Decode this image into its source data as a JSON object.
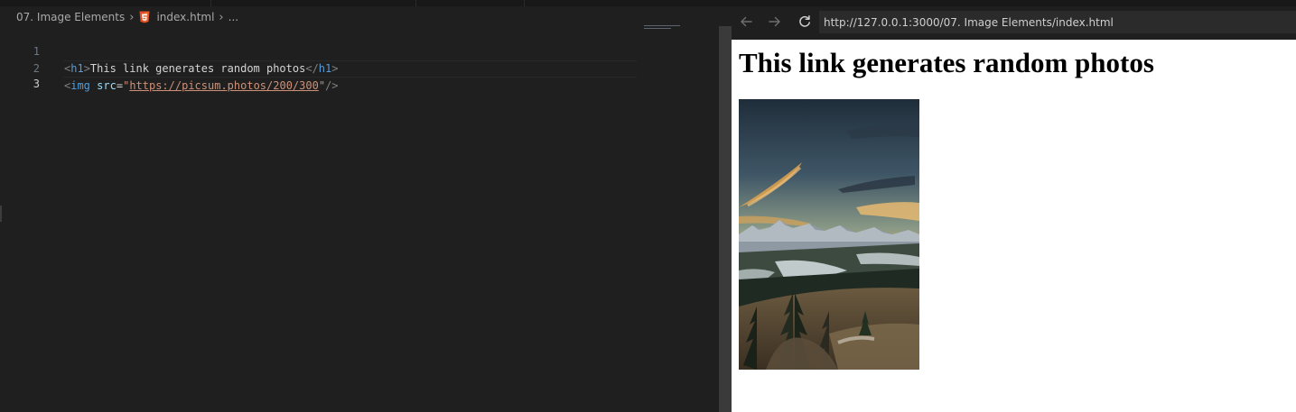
{
  "editor": {
    "breadcrumb": {
      "folder": "07. Image Elements",
      "file": "index.html",
      "more": "..."
    },
    "lines": [
      {
        "number": "1",
        "tokens": {
          "open_lt": "<",
          "open_tag": "h1",
          "open_gt": ">",
          "text": "This link generates random photos",
          "close_lt": "</",
          "close_tag": "h1",
          "close_gt": ">"
        }
      },
      {
        "number": "2",
        "tokens": {
          "lt": "<",
          "tag": "img",
          "attr": "src",
          "eq": "=",
          "quote_open": "\"",
          "url": "https://picsum.photos/200/300",
          "quote_close": "\"",
          "end": "/>"
        }
      },
      {
        "number": "3",
        "tokens": {}
      }
    ]
  },
  "browser": {
    "url": "http://127.0.0.1:3000/07. Image Elements/index.html",
    "back_icon": "arrow-left-icon",
    "forward_icon": "arrow-right-icon",
    "reload_icon": "reload-icon",
    "page": {
      "heading": "This link generates random photos",
      "image": "landscape photo: mountains at sunset with pine trees"
    }
  },
  "colors": {
    "editor_bg": "#1f1f1f",
    "tag": "#569cd6",
    "attribute": "#9cdcfe",
    "string": "#ce9178",
    "html_icon": "#e44d26"
  }
}
